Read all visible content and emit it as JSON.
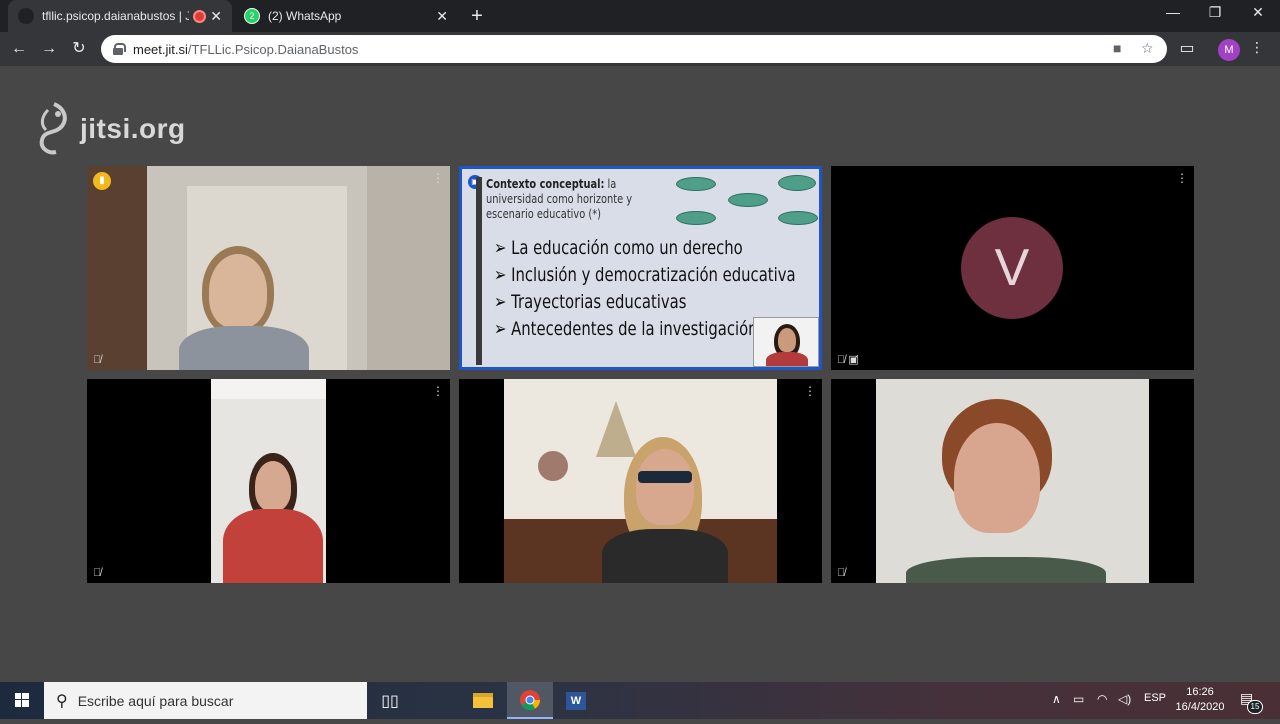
{
  "browser": {
    "tabs": [
      {
        "title": "tfllic.psicop.daianabustos | Jit",
        "active": true,
        "recording": true
      },
      {
        "title": "(2) WhatsApp",
        "active": false,
        "badge": "2"
      }
    ],
    "new_tab": "+",
    "window_controls": {
      "minimize": "—",
      "restore": "❐",
      "close": "✕"
    },
    "url_host": "meet.jit.si",
    "url_path": "/TFLLic.Psicop.DaianaBustos",
    "profile_initial": "M"
  },
  "jitsi": {
    "logo_text": "jitsi.org",
    "tiles": [
      {
        "kind": "video",
        "muted": true,
        "speaker_badge": true
      },
      {
        "kind": "screen-share"
      },
      {
        "kind": "avatar",
        "avatar_letter": "V",
        "muted": true,
        "video_off": true
      },
      {
        "kind": "video",
        "muted": true
      },
      {
        "kind": "video",
        "muted": false
      },
      {
        "kind": "video",
        "muted": true
      }
    ],
    "slide": {
      "heading_bold": "Contexto conceptual:",
      "heading_rest": " la universidad como horizonte y escenario educativo (*)",
      "bullets": [
        "La educación como un derecho",
        "Inclusión y democratización educativa",
        "Trayectorias educativas",
        "Antecedentes de la investigación"
      ],
      "bullet_marker": "➢"
    }
  },
  "taskbar": {
    "search_placeholder": "Escribe aquí para buscar",
    "language": "ESP",
    "time": "16:26",
    "date": "16/4/2020",
    "notifications": "15"
  }
}
